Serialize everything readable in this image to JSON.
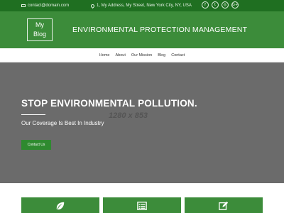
{
  "topbar": {
    "email": "contact@domain.com",
    "address": "1, My Address, My Street, New York City, NY, USA",
    "social": [
      {
        "icon": "facebook-icon",
        "glyph": "f"
      },
      {
        "icon": "twitter-icon",
        "glyph": "t"
      },
      {
        "icon": "instagram-icon",
        "glyph": "◎"
      },
      {
        "icon": "google-plus-icon",
        "glyph": "G+"
      }
    ]
  },
  "header": {
    "logo_line1": "My",
    "logo_line2": "Blog",
    "site_title": "ENVIRONMENTAL PROTECTION MANAGEMENT"
  },
  "nav": {
    "items": [
      "Home",
      "About",
      "Our Mission",
      "Blog",
      "Contact"
    ]
  },
  "hero": {
    "image_placeholder": "1280 x 853",
    "title": "STOP ENVIRONMENTAL POLLUTION.",
    "subtitle": "Our Coverage Is Best In Industry",
    "cta_label": "Contact Us"
  },
  "features": {
    "icons": [
      "leaf-icon",
      "list-icon",
      "edit-icon"
    ]
  },
  "colors": {
    "topbar": "#1f6f21",
    "brand": "#3c8c3a",
    "hero_bg": "#6b6b6b",
    "cta": "#2e8a2f"
  }
}
